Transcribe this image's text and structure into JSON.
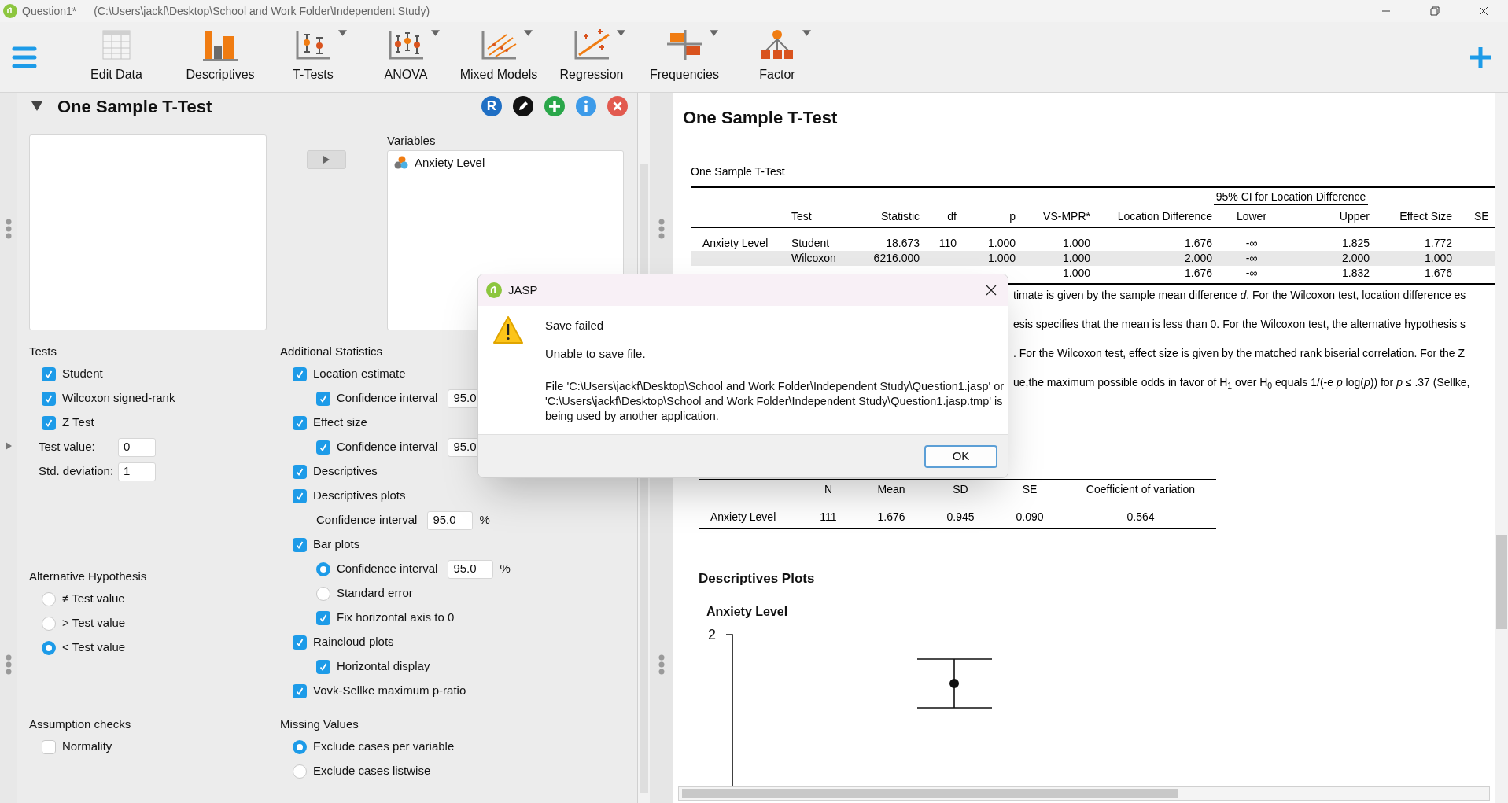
{
  "window": {
    "title": "Question1*",
    "path": "(C:\\Users\\jackf\\Desktop\\School and Work Folder\\Independent Study)"
  },
  "toolbar": [
    {
      "label": "Edit Data",
      "menu": false
    },
    {
      "label": "Descriptives",
      "menu": false
    },
    {
      "label": "T-Tests",
      "menu": true
    },
    {
      "label": "ANOVA",
      "menu": true
    },
    {
      "label": "Mixed Models",
      "menu": true
    },
    {
      "label": "Regression",
      "menu": true
    },
    {
      "label": "Frequencies",
      "menu": true
    },
    {
      "label": "Factor",
      "menu": true
    }
  ],
  "analysis": {
    "title": "One Sample T-Test",
    "expanded": true,
    "r_button": "R",
    "variables_label": "Variables",
    "variables": [
      {
        "name": "Anxiety Level"
      }
    ],
    "tests": {
      "title": "Tests",
      "options": [
        {
          "kind": "checkbox",
          "label": "Student",
          "checked": true
        },
        {
          "kind": "checkbox",
          "label": "Wilcoxon signed-rank",
          "checked": true
        },
        {
          "kind": "checkbox",
          "label": "Z Test",
          "checked": true
        }
      ]
    },
    "test_fields": [
      {
        "label": "Test value:",
        "value": "0"
      },
      {
        "label": "Std. deviation:",
        "value": "1"
      }
    ],
    "alternative_hypothesis": {
      "title": "Alternative Hypothesis",
      "options": [
        {
          "kind": "radio",
          "label": "≠ Test value",
          "selected": false
        },
        {
          "kind": "radio",
          "label": "> Test value",
          "selected": false
        },
        {
          "kind": "radio",
          "label": "< Test value",
          "selected": true
        }
      ]
    },
    "additional_statistics": {
      "title": "Additional Statistics",
      "options": [
        {
          "kind": "checkbox",
          "label": "Location estimate",
          "checked": true,
          "children": [
            {
              "kind": "checkbox",
              "label": "Confidence interval",
              "checked": true,
              "value": "95.0"
            }
          ]
        },
        {
          "kind": "checkbox",
          "label": "Effect size",
          "checked": true,
          "children": [
            {
              "kind": "checkbox",
              "label": "Confidence interval",
              "checked": true,
              "value": "95.0"
            }
          ]
        },
        {
          "kind": "checkbox",
          "label": "Descriptives",
          "checked": true
        },
        {
          "kind": "checkbox",
          "label": "Descriptives plots",
          "checked": true,
          "children": [
            {
              "kind": "field",
              "label": "Confidence interval",
              "value": "95.0",
              "unit": "%"
            }
          ]
        },
        {
          "kind": "checkbox",
          "label": "Bar plots",
          "checked": true,
          "children": [
            {
              "kind": "radio",
              "label": "Confidence interval",
              "selected": true,
              "value": "95.0",
              "unit": "%"
            },
            {
              "kind": "radio",
              "label": "Standard error",
              "selected": false
            },
            {
              "kind": "checkbox",
              "label": "Fix horizontal axis to 0",
              "checked": true
            }
          ]
        },
        {
          "kind": "checkbox",
          "label": "Raincloud plots",
          "checked": true,
          "children": [
            {
              "kind": "checkbox",
              "label": "Horizontal display",
              "checked": true
            }
          ]
        },
        {
          "kind": "checkbox",
          "label": "Vovk-Sellke maximum p-ratio",
          "checked": true
        }
      ]
    },
    "assumption_checks": {
      "title": "Assumption checks",
      "options": [
        {
          "kind": "checkbox",
          "label": "Normality",
          "checked": false
        }
      ]
    },
    "missing_values": {
      "title": "Missing Values",
      "options": [
        {
          "kind": "radio",
          "label": "Exclude cases per variable",
          "selected": true
        },
        {
          "kind": "radio",
          "label": "Exclude cases listwise",
          "selected": false
        }
      ]
    }
  },
  "results": {
    "title": "One Sample T-Test",
    "ttest_table": {
      "caption": "One Sample T-Test",
      "spanner": "95% CI for Location Difference",
      "columns": [
        "Test",
        "Statistic",
        "df",
        "p",
        "VS-MPR*",
        "Location Difference",
        "Lower",
        "Upper",
        "Effect Size",
        "SE"
      ],
      "rows": [
        {
          "variable": "Anxiety Level",
          "highlighted": false,
          "cells": [
            "Student",
            "18.673",
            "110",
            "1.000",
            "1.000",
            "1.676",
            "-∞",
            "1.825",
            "1.772"
          ]
        },
        {
          "highlighted": true,
          "cells": [
            "Wilcoxon",
            "6216.000",
            null,
            "1.000",
            "1.000",
            "2.000",
            "-∞",
            "2.000",
            "1.000"
          ]
        },
        {
          "highlighted": false,
          "cells": [
            null,
            null,
            null,
            null,
            "1.000",
            "1.676",
            "-∞",
            "1.832",
            "1.676"
          ]
        }
      ],
      "footnotes": [
        "timate is given by the sample mean difference *d*. For the Wilcoxon test, location difference es",
        "esis specifies that the mean is less than 0. For the Wilcoxon test, the alternative hypothesis s",
        ". For the Wilcoxon test, effect size is given by the matched rank biserial correlation. For the Z",
        "ue,the maximum possible odds in favor of H$_{1}$ over H$_{0}$ equals 1/(-e *p* log(*p*)) for *p* ≤ .37 (Sellke,"
      ]
    },
    "descriptives_table": {
      "columns": [
        "N",
        "Mean",
        "SD",
        "SE",
        "Coefficient of variation"
      ],
      "rows": [
        {
          "variable": "Anxiety Level",
          "cells": [
            "111",
            "1.676",
            "0.945",
            "0.090",
            "0.564"
          ]
        }
      ]
    },
    "plots_title": "Descriptives Plots",
    "plot": {
      "title": "Anxiety Level",
      "y_tick": "2"
    }
  },
  "dialog": {
    "title": "JASP",
    "heading": "Save failed",
    "message": "Unable to save file.",
    "detail": "File 'C:\\Users\\jackf\\Desktop\\School and Work Folder\\Independent Study\\Question1.jasp' or 'C:\\Users\\jackf\\Desktop\\School and Work Folder\\Independent Study\\Question1.jasp.tmp' is being used by another application.",
    "button": "OK"
  }
}
